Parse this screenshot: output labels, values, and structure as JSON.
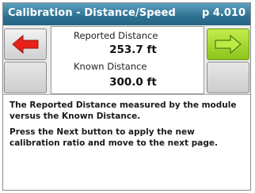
{
  "header": {
    "title": "Calibration - Distance/Speed",
    "page": "p 4.010"
  },
  "colors": {
    "title_bar": "#2f7192",
    "back_arrow": "#e8201a",
    "next_arrow": "#a6e03a"
  },
  "buttons": {
    "back_icon": "left-arrow-icon",
    "next_icon": "right-arrow-icon"
  },
  "fields": {
    "reported": {
      "label": "Reported Distance",
      "value": "253.7 ft"
    },
    "known": {
      "label": "Known Distance",
      "value": "300.0 ft"
    }
  },
  "description": {
    "line1": "The Reported Distance measured by the module versus the Known Distance.",
    "line2": "Press the Next button to apply the new calibration ratio and move to the next page."
  }
}
